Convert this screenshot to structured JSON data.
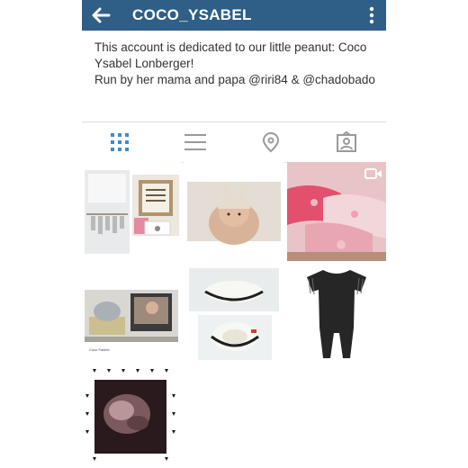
{
  "app": {
    "username": "COCO_YSABEL",
    "back_icon": "arrow-left-icon",
    "menu_icon": "more-vertical-icon",
    "bar_color": "#2f5f86"
  },
  "bio": {
    "line1": "This account is dedicated to our little peanut: Coco Ysabel Lonberger!",
    "line2": "Run by her mama and papa @riri84 & @chadobado"
  },
  "tabs": [
    {
      "icon": "grid-view-icon",
      "active": true,
      "color": "#3c8dc7"
    },
    {
      "icon": "list-view-icon",
      "active": false
    },
    {
      "icon": "location-pin-icon",
      "active": false
    },
    {
      "icon": "tagged-photos-icon",
      "active": false
    }
  ],
  "posts": [
    {
      "subject": "nursery shelf and framed print",
      "video": false
    },
    {
      "subject": "baby in knit bunny hat",
      "video": false
    },
    {
      "subject": "folded pink floral blankets",
      "video": true,
      "badge_icon": "video-camera-icon"
    },
    {
      "subject": "baby desk photo with knit beanie",
      "video": false,
      "caption": "Coco Fashel"
    },
    {
      "subject": "crochet baby booties",
      "video": false
    },
    {
      "subject": "black fringe baby romper",
      "video": false
    },
    {
      "subject": "ultrasound photo in triangle print frame",
      "video": false
    }
  ]
}
